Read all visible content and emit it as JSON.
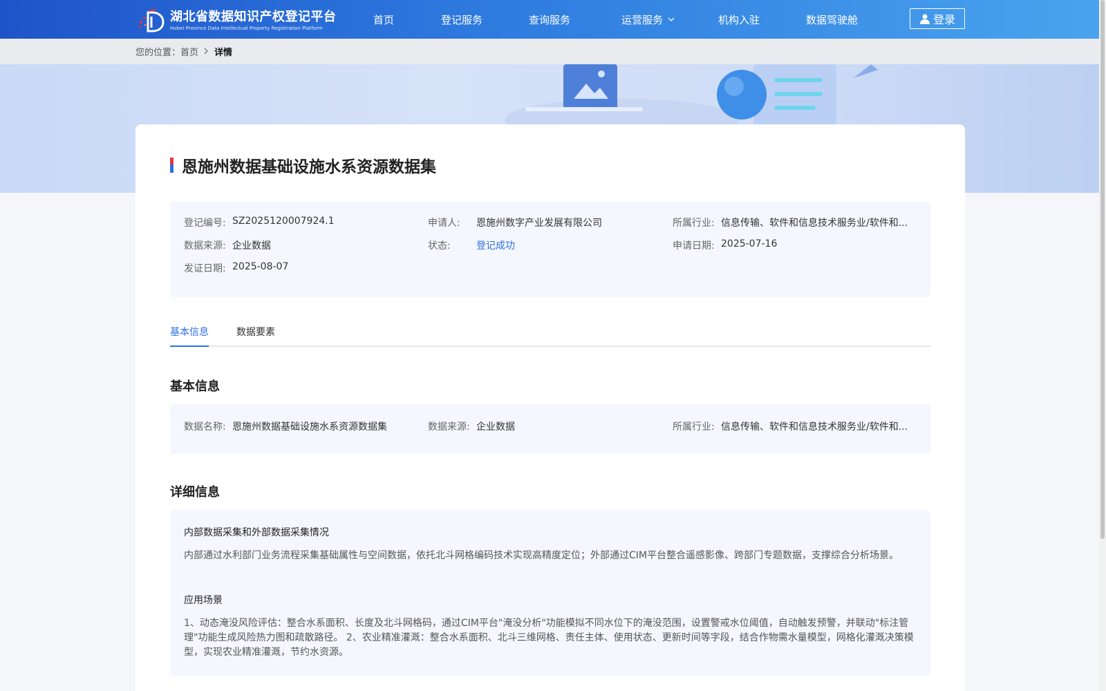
{
  "header": {
    "logo_cn": "湖北省数据知识产权登记平台",
    "logo_en": "Hubei Province Data Intellectual Property Registration Platform",
    "nav": [
      "首页",
      "登记服务",
      "查询服务",
      "运营服务",
      "机构入驻",
      "数据驾驶舱"
    ],
    "login": "登录"
  },
  "breadcrumb": {
    "prefix": "您的位置：",
    "home": "首页",
    "current": "详情"
  },
  "record": {
    "title": "恩施州数据基础设施水系资源数据集",
    "fields": {
      "reg_no_label": "登记编号:",
      "reg_no": "SZ2025120007924.1",
      "applicant_label": "申请人:",
      "applicant": "恩施州数字产业发展有限公司",
      "industry_label": "所属行业:",
      "industry": "信息传输、软件和信息技术服务业/软件和...",
      "source_label": "数据来源:",
      "source": "企业数据",
      "status_label": "状态:",
      "status": "登记成功",
      "apply_date_label": "申请日期:",
      "apply_date": "2025-07-16",
      "cert_date_label": "发证日期:",
      "cert_date": "2025-08-07"
    }
  },
  "tabs": [
    "基本信息",
    "数据要素"
  ],
  "basic": {
    "section_title": "基本信息",
    "name_label": "数据名称:",
    "name": "恩施州数据基础设施水系资源数据集",
    "source_label": "数据来源:",
    "source": "企业数据",
    "industry_label": "所属行业:",
    "industry": "信息传输、软件和信息技术服务业/软件和..."
  },
  "detail": {
    "section_title": "详细信息",
    "collection_heading": "内部数据采集和外部数据采集情况",
    "collection_text": "内部通过水利部门业务流程采集基础属性与空间数据，依托北斗网格编码技术实现高精度定位；外部通过CIM平台整合遥感影像、跨部门专题数据，支撑综合分析场景。",
    "scenario_heading": "应用场景",
    "scenario_text": "1、动态淹没风险评估：整合水系面积、长度及北斗网格码，通过CIM平台\"淹没分析\"功能模拟不同水位下的淹没范围，设置警戒水位阈值，自动触发预警，并联动\"标注管理\"功能生成风险热力图和疏散路径。 2、农业精准灌溉：整合水系面积、北斗三维网格、责任主体、使用状态、更新时间等字段，结合作物需水量模型，网格化灌溉决策模型，实现农业精准灌溉，节约水资源。"
  },
  "colors": {
    "primary": "#2d6fe0",
    "header_start": "#1f54c9",
    "header_end": "#4aa3ee",
    "panel_bg": "#f4f7fd"
  }
}
